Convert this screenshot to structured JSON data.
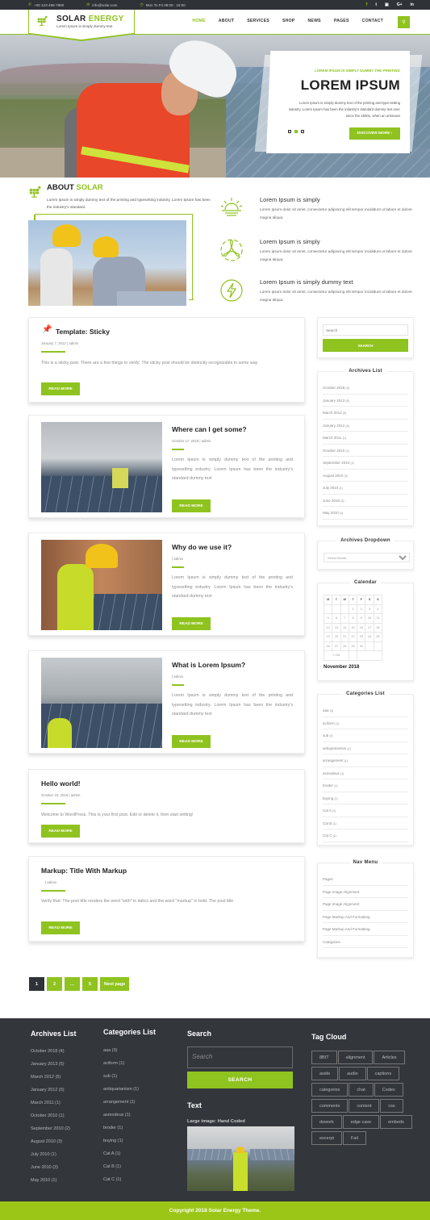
{
  "topbar": {
    "phone": "+00 123-456-7890",
    "email": "info@solar.com",
    "hours": "Mon To Fri 08:00 - 18:00",
    "social": [
      "f",
      "t",
      "yt",
      "G+",
      "in"
    ]
  },
  "brand": {
    "title_a": "SOLAR ",
    "title_b": "ENERGY",
    "tagline": "Lorem Ipsum is simply dummy text",
    "accent": "#8fc31f"
  },
  "nav": {
    "items": [
      "HOME",
      "ABOUT",
      "SERVICES",
      "SHOP",
      "NEWS",
      "PAGES",
      "CONTACT"
    ],
    "active": "HOME",
    "search_icon": "search-icon"
  },
  "hero": {
    "kicker": "LOREM IPSUM IS SIMPLY DUMMY THE PRINTING",
    "title": "LOREM IPSUM",
    "text": "Lorem Ipsum is simply dummy text of the printing and type-setting industry. Lorem Ipsum has been the industry's standard dummy text ever since the 1500s, when an unknown",
    "button": "DISCOVER MORE ›",
    "slides": 3,
    "active_slide": 2
  },
  "about": {
    "title_a": "ABOUT ",
    "title_b": "SOLAR",
    "text": "Lorem Ipsum is simply dummy text of the printing and typesetting industry. Lorem Ipsum has been the industry's standard.",
    "features": [
      {
        "icon": "sun-icon",
        "title": "Lorem Ipsum is simply",
        "text": "Lorem ipsum dolor sit amet, consectetur adipiscing elit tempor incididunt ut labore et dolore magna aliqua."
      },
      {
        "icon": "wind-turbine-icon",
        "title": "Lorem Ipsum is simply",
        "text": "Lorem ipsum dolor sit amet, consectetur adipiscing elit tempor incididunt ut labore et dolore magna aliqua."
      },
      {
        "icon": "lightning-icon",
        "title": "Lorem Ipsum is simply dummy text",
        "text": "Lorem ipsum dolor sit amet, consectetur adipiscing elit tempor incididunt ut labore et dolore magna aliqua."
      }
    ]
  },
  "posts": [
    {
      "title": "Template: Sticky",
      "meta": "January 7, 2012  |  admin",
      "excerpt": "This is a sticky post. There are a few things to verify: The sticky post should be distinctly recognizable in some way",
      "button": "READ MORE",
      "sticky": true
    },
    {
      "title": "Where can I get some?",
      "meta": "October 17, 2018 |  admin",
      "excerpt": "Lorem Ipsum is simply dummy text of the printing and typesetting industry. Lorem Ipsum has been the industry's standard dummy text",
      "button": "READ MORE"
    },
    {
      "title": "Why do we use it?",
      "meta": "|  admin",
      "excerpt": "Lorem Ipsum is simply dummy text of the printing and typesetting industry. Lorem Ipsum has been the industry's standard dummy text",
      "button": "READ MORE"
    },
    {
      "title": "What is Lorem Ipsum?",
      "meta": "|  admin",
      "excerpt": "Lorem Ipsum is simply dummy text of the printing and typesetting industry. Lorem Ipsum has been the industry's standard dummy text",
      "button": "READ MORE"
    },
    {
      "title": "Hello world!",
      "meta": "October 15, 2018  |  admin",
      "excerpt": "Welcome to WordPress. This is your first post. Edit or delete it, then start writing!",
      "button": "READ MORE"
    },
    {
      "title": "Markup: Title With Markup",
      "meta": "|  admin",
      "excerpt": "Verify that: The post title renders the word \"with\" in italics and the word \"markup\" in bold. The post title",
      "button": "READ MORE"
    }
  ],
  "pagination": [
    "1",
    "2",
    "…",
    "5",
    "Next page"
  ],
  "sidebar": {
    "search_placeholder": "Search",
    "search_button": "SEARCH",
    "archives_title": "Archives List",
    "archives": [
      {
        "label": "October 2018",
        "count": "(4)"
      },
      {
        "label": "January 2013",
        "count": "(5)"
      },
      {
        "label": "March 2012",
        "count": "(5)"
      },
      {
        "label": "January 2012",
        "count": "(6)"
      },
      {
        "label": "March 2011",
        "count": "(1)"
      },
      {
        "label": "October 2010",
        "count": "(1)"
      },
      {
        "label": "September 2010",
        "count": "(2)"
      },
      {
        "label": "August 2010",
        "count": "(3)"
      },
      {
        "label": "July 2010",
        "count": "(1)"
      },
      {
        "label": "June 2010",
        "count": "(3)"
      },
      {
        "label": "May 2010",
        "count": "(1)"
      }
    ],
    "dropdown_title": "Archives Dropdown",
    "dropdown_value": "Select Month",
    "calendar_title": "Calendar",
    "calendar_days": [
      "M",
      "T",
      "W",
      "T",
      "F",
      "S",
      "S"
    ],
    "calendar_rows": [
      [
        "",
        "",
        "",
        "1",
        "2",
        "3",
        "4"
      ],
      [
        "5",
        "6",
        "7",
        "8",
        "9",
        "10",
        "11"
      ],
      [
        "12",
        "13",
        "14",
        "15",
        "16",
        "17",
        "18"
      ],
      [
        "19",
        "20",
        "21",
        "22",
        "23",
        "24",
        "25"
      ],
      [
        "26",
        "27",
        "28",
        "29",
        "30",
        "",
        ""
      ]
    ],
    "calendar_prev": "« Oct",
    "calendar_month": "November 2018",
    "categories_title": "Categories List",
    "categories": [
      {
        "label": "aaa",
        "count": "(3)"
      },
      {
        "label": "aciform",
        "count": "(1)"
      },
      {
        "label": "sub",
        "count": "(1)"
      },
      {
        "label": "antiquarianism",
        "count": "(1)"
      },
      {
        "label": "arrangement",
        "count": "(1)"
      },
      {
        "label": "asmodeus",
        "count": "(1)"
      },
      {
        "label": "broder",
        "count": "(1)"
      },
      {
        "label": "buying",
        "count": "(1)"
      },
      {
        "label": "Cat A",
        "count": "(1)"
      },
      {
        "label": "Cat B",
        "count": "(1)"
      },
      {
        "label": "Cat C",
        "count": "(1)"
      }
    ],
    "navmenu_title": "Nav Menu",
    "navmenu": [
      "Pages",
      "Page Image Alignment",
      "Page Image Alignment",
      "Page Markup And Formatting",
      "Page Markup And Formatting",
      "Categories"
    ]
  },
  "footer": {
    "archives_title": "Archives List",
    "categories_title": "Categories List",
    "search_title": "Search",
    "search_placeholder": "Search",
    "search_button": "SEARCH",
    "text_title": "Text",
    "image_caption": "Large image: Hand Coded",
    "tags_title": "Tag Cloud",
    "tags": [
      "8BIT",
      "alignment",
      "Articles",
      "aside",
      "audio",
      "captions",
      "categories",
      "chat",
      "Codex",
      "comments",
      "content",
      "css",
      "dowork",
      "edge case",
      "embeds",
      "excerpt",
      "Fail"
    ],
    "copyright": "Copyright 2018 Solar Energy Theme."
  }
}
